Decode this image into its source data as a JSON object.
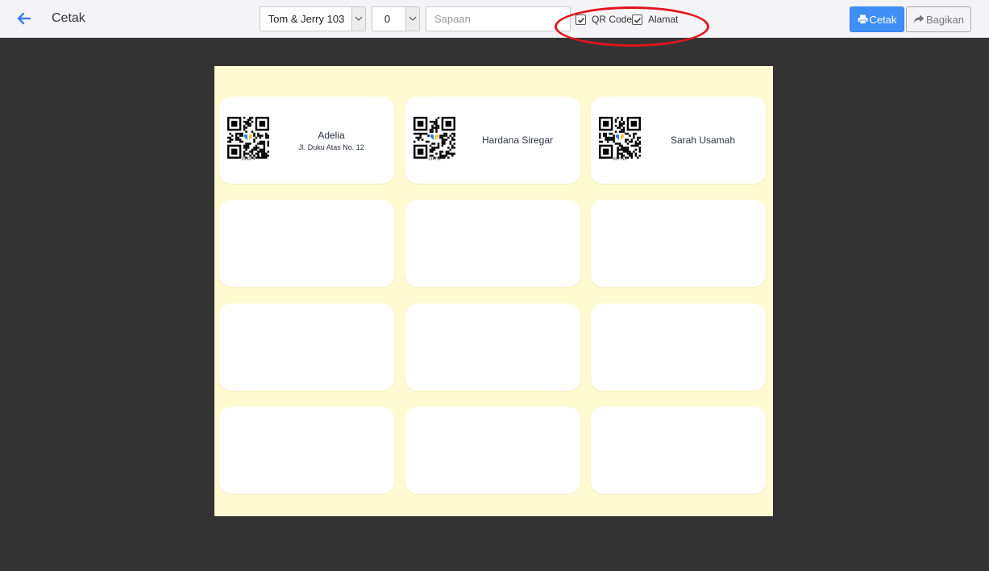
{
  "header": {
    "title": "Cetak",
    "event_select": "Tom & Jerry 103",
    "number_select": "0",
    "sapaan_placeholder": "Sapaan",
    "sapaan_value": "",
    "qr_label": "QR Code",
    "qr_checked": true,
    "alamat_label": "Alamat",
    "alamat_checked": true,
    "print_label": "Cetak",
    "share_label": "Bagikan"
  },
  "colors": {
    "page_bg": "#333333",
    "paper": "#fefbd2",
    "primary": "#3f8ef6",
    "highlight": "#e0141e"
  },
  "cards": [
    {
      "name": "Adelia",
      "address": "Jl. Duku Atas No. 12",
      "code": "259374"
    },
    {
      "name": "Hardana Siregar",
      "address": "",
      "code": "134711"
    },
    {
      "name": "Sarah Usamah",
      "address": "",
      "code": "687712"
    }
  ]
}
